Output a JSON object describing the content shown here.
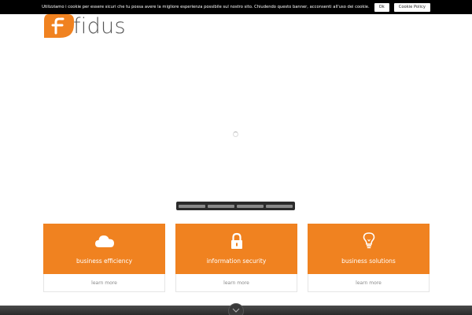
{
  "cookie_banner": {
    "text": "Utilizziamo i cookie per essere sicuri che tu possa avere la migliore esperienza possibile sul nostro sito. Chiudendo questo banner, acconsenti all'uso dei cookie.",
    "ok_label": "Ok",
    "policy_label": "Cookie Policy"
  },
  "logo": {
    "text": "fidus",
    "accent": "#f08220"
  },
  "slider": {
    "slides": 4,
    "active": 1
  },
  "features": [
    {
      "icon": "cloud-icon",
      "title": "business efficiency",
      "link": "learn more"
    },
    {
      "icon": "lock-icon",
      "title": "information security",
      "link": "learn more"
    },
    {
      "icon": "lightbulb-icon",
      "title": "business solutions",
      "link": "learn more"
    }
  ],
  "colors": {
    "accent": "#f08220",
    "dark": "#2b2b2b"
  }
}
